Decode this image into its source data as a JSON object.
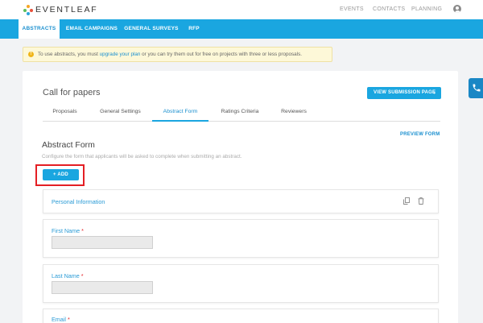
{
  "app": {
    "brand": "EVENTLEAF"
  },
  "topnav": [
    {
      "label": "EVENTS"
    },
    {
      "label": "CONTACTS"
    },
    {
      "label": "PLANNING"
    }
  ],
  "tabs": [
    {
      "label": "ABSTRACTS",
      "active": true
    },
    {
      "label": "EMAIL CAMPAIGNS"
    },
    {
      "label": "GENERAL SURVEYS"
    },
    {
      "label": "RFP"
    }
  ],
  "notice": {
    "before": "To use abstracts, you must ",
    "link": "upgrade your plan",
    "after": " or you can try them out for free on projects with three or less proposals."
  },
  "page": {
    "title": "Call for papers",
    "view_submission_label": "VIEW SUBMISSION PAGE",
    "subtabs": [
      {
        "label": "Proposals"
      },
      {
        "label": "General Settings"
      },
      {
        "label": "Abstract Form",
        "active": true
      },
      {
        "label": "Ratings Criteria"
      },
      {
        "label": "Reviewers"
      }
    ],
    "preview_form_label": "PREVIEW FORM",
    "section_title": "Abstract Form",
    "section_desc": "Configure the form that applicants will be asked to complete when submitting an abstract.",
    "add_label": "+ ADD"
  },
  "form": {
    "section_name": "Personal Information",
    "fields": [
      {
        "label": "First Name",
        "required": "*"
      },
      {
        "label": "Last Name",
        "required": "*"
      },
      {
        "label": "Email",
        "required": "*"
      }
    ]
  },
  "colors": {
    "accent": "#1aa6e0",
    "highlight": "#e41f24",
    "notice_bg": "#fdf8d8"
  },
  "icons": {
    "warning": "warning-icon",
    "copy": "copy-icon",
    "delete": "trash-icon",
    "phone": "phone-icon",
    "user": "user-icon"
  }
}
